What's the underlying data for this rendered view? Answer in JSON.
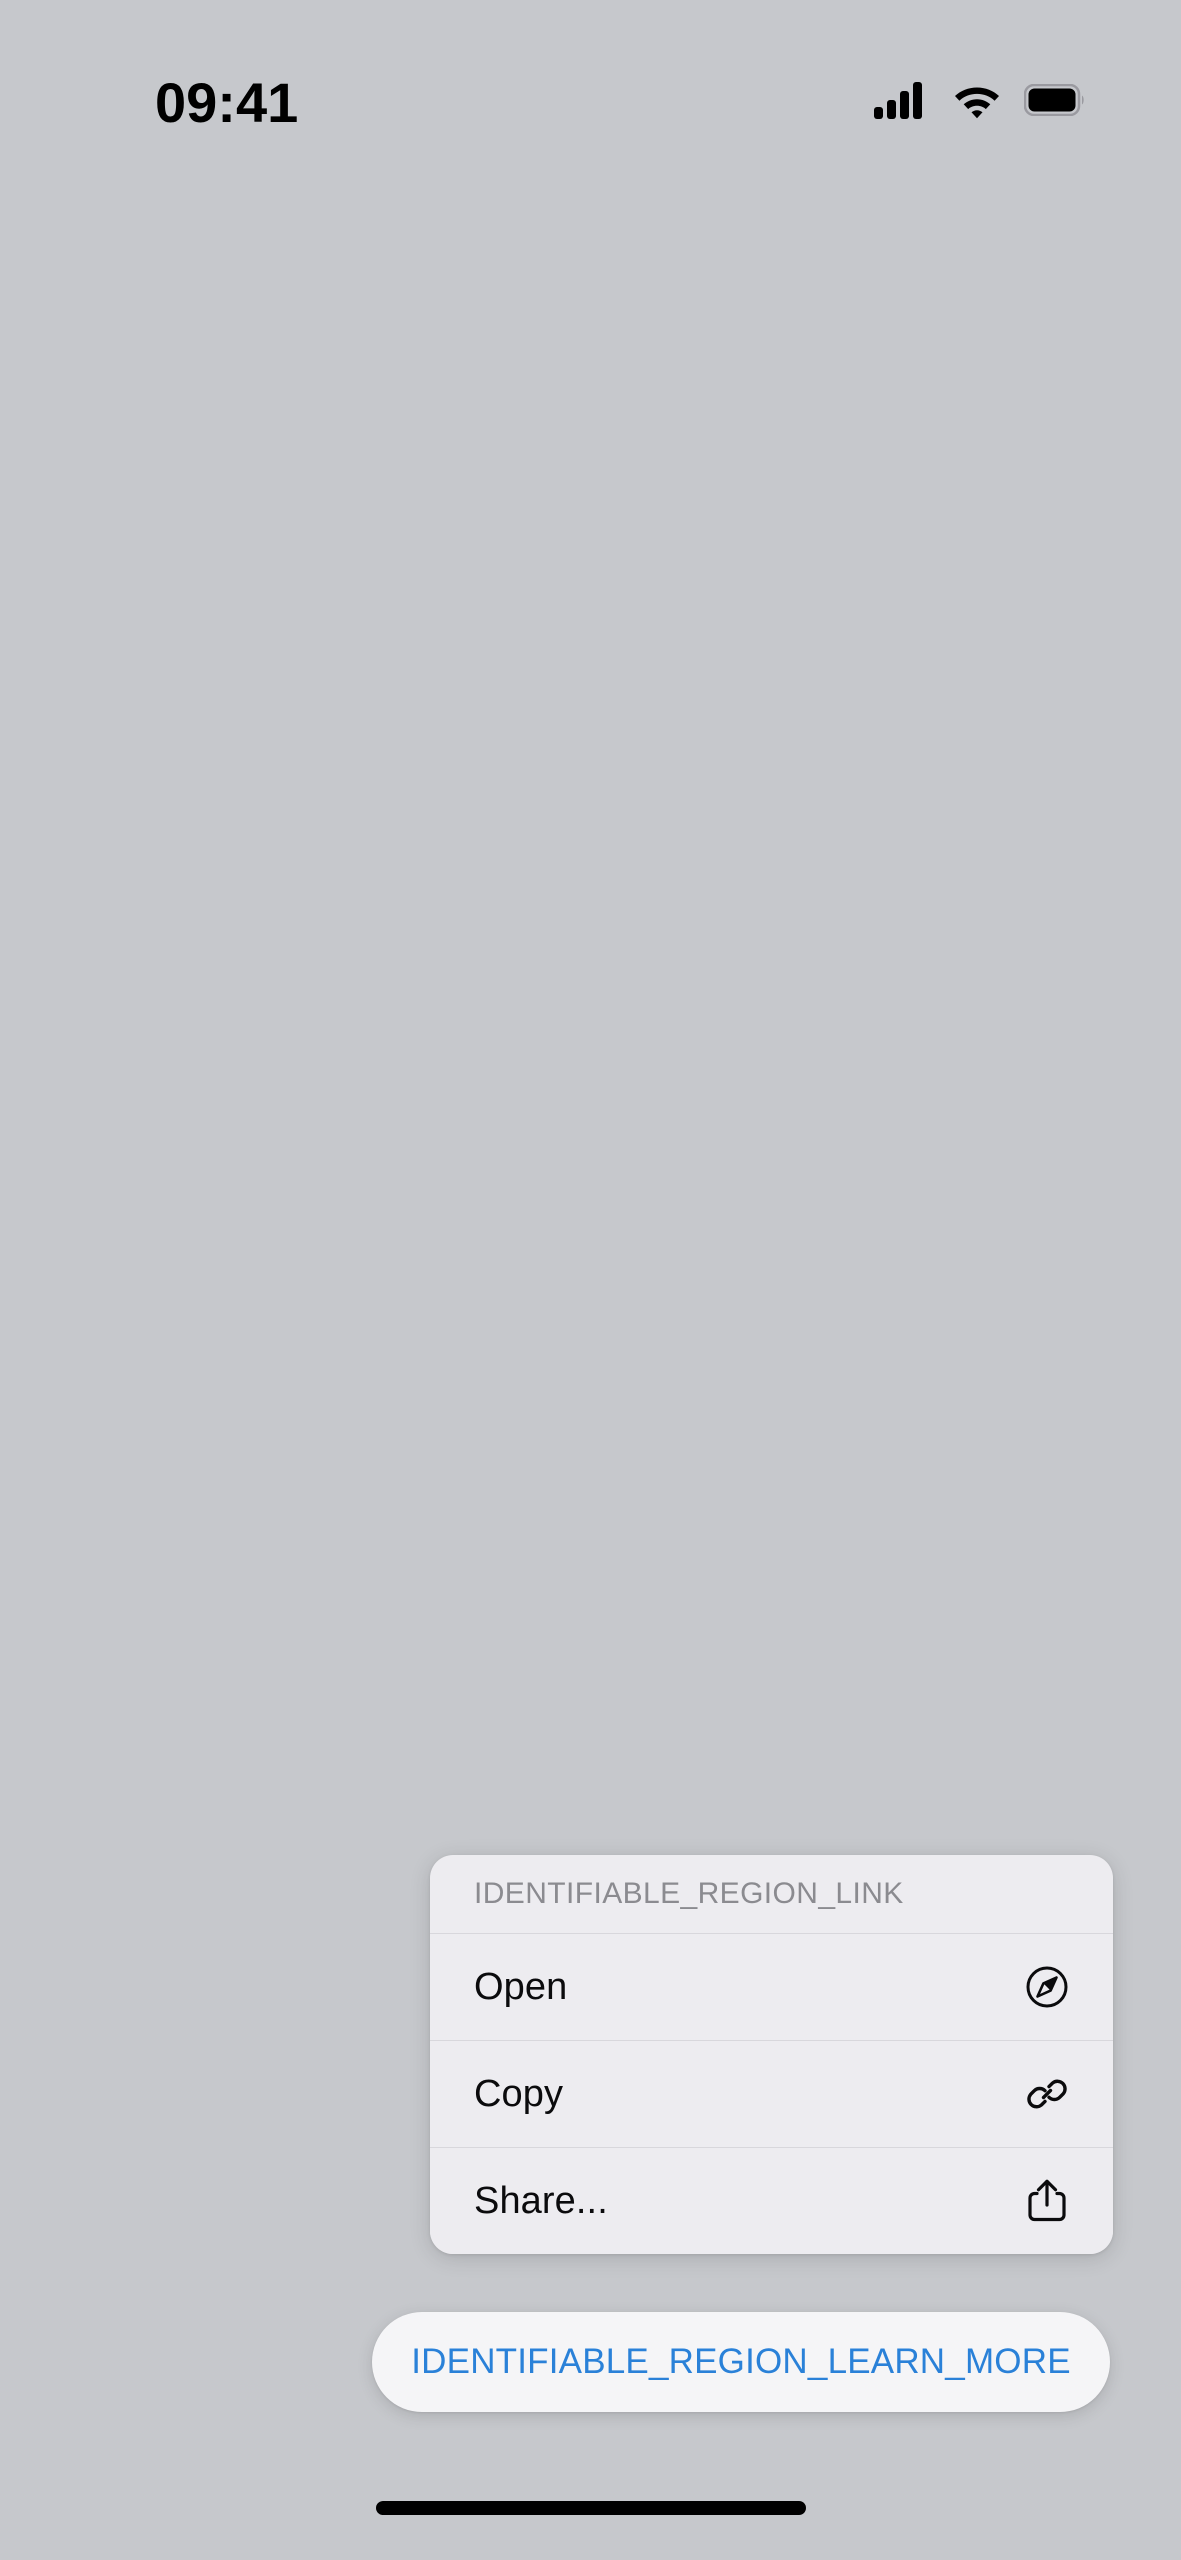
{
  "status_bar": {
    "time": "09:41",
    "icons": [
      {
        "name": "cellular-signal-icon",
        "bars": 4,
        "filled": 4
      },
      {
        "name": "wifi-icon",
        "level": 3
      },
      {
        "name": "battery-icon",
        "level": 100
      }
    ]
  },
  "context_menu": {
    "header": "IDENTIFIABLE_REGION_LINK",
    "items": [
      {
        "label": "Open",
        "icon": "safari-compass-icon"
      },
      {
        "label": "Copy",
        "icon": "link-chain-icon"
      },
      {
        "label": "Share...",
        "icon": "share-icon"
      }
    ]
  },
  "learn_more_button": {
    "label": "IDENTIFIABLE_REGION_LEARN_MORE"
  },
  "colors": {
    "background": "#c6c8cc",
    "menu_surface": "#edecf0",
    "menu_separator": "#d8d7dc",
    "menu_header_text": "#8b8b90",
    "menu_item_text": "#0b0b0d",
    "link_blue": "#2a81d8",
    "pill_surface": "#f5f5f7",
    "home_indicator": "#000000"
  }
}
